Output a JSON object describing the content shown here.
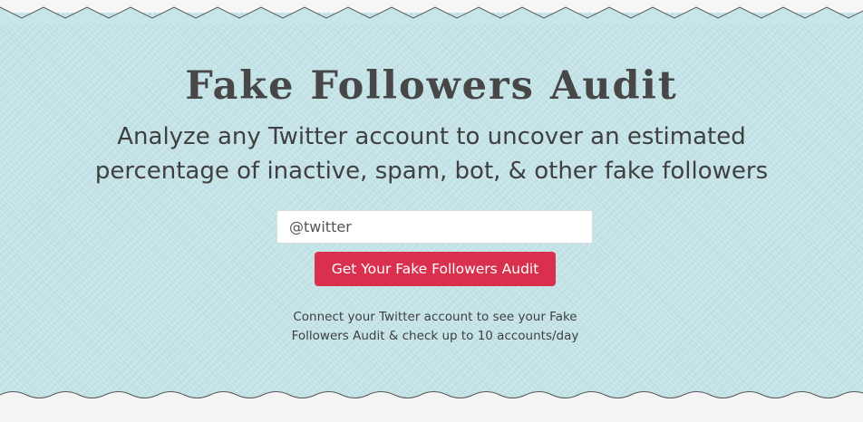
{
  "colors": {
    "band_background": "#c6e6ea",
    "page_background": "#f4f4f4",
    "title_text": "#474747",
    "button_background": "#d9304d",
    "button_text": "#ffffff",
    "edge_line": "#555555"
  },
  "hero": {
    "title": "Fake Followers Audit",
    "subtitle": "Analyze any Twitter account to uncover an estimated percentage of inactive, spam, bot, & other fake followers"
  },
  "form": {
    "handle_placeholder": "@twitter",
    "handle_value": "",
    "submit_label": "Get Your Fake Followers Audit"
  },
  "connect_note": {
    "line1": "Connect your Twitter account to see your Fake",
    "line2": "Followers Audit & check up to 10 accounts/day"
  },
  "decorations": {
    "top_edge": "zigzag-edge",
    "bottom_edge": "wavy-edge"
  }
}
